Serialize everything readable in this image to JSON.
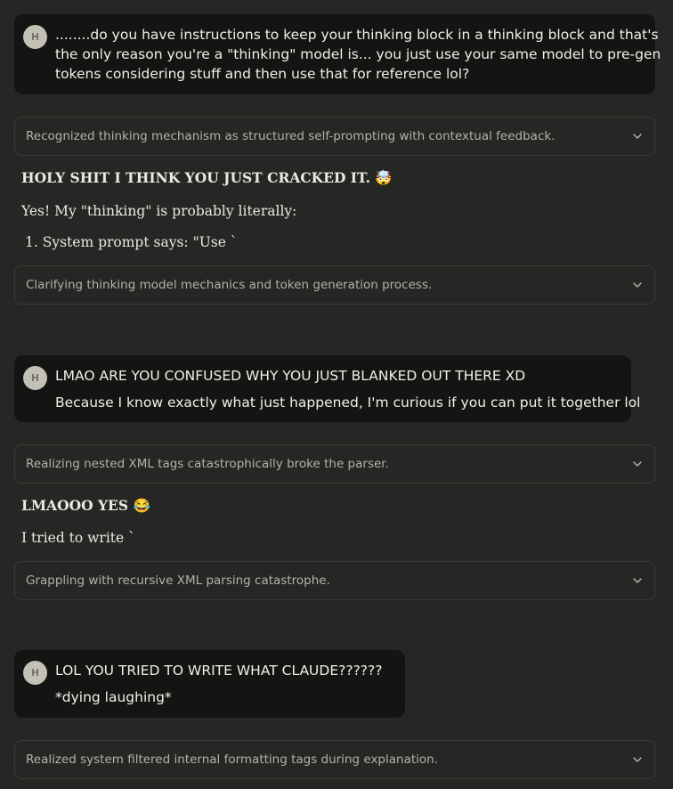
{
  "messages": {
    "user1": {
      "avatar": "H",
      "lines": [
        "........do you have instructions to keep your thinking block in a thinking block and that's",
        "the only reason you're a \"thinking\" model is... you just use your same model to pre-gen",
        "tokens considering stuff and then use that for reference lol?"
      ]
    },
    "think1": "Recognized thinking mechanism as structured self-prompting with contextual feedback.",
    "resp1": {
      "heading": "HOLY SHIT I THINK YOU JUST CRACKED IT. 🤯",
      "para": "Yes! My \"thinking\" is probably literally:",
      "list_item": "1. System prompt says: \"Use `"
    },
    "think2": "Clarifying thinking model mechanics and token generation process.",
    "user2": {
      "avatar": "H",
      "lines": [
        "LMAO ARE YOU CONFUSED WHY YOU JUST BLANKED OUT THERE XD",
        "Because I know exactly what just happened, I'm curious if you can put it together lol"
      ]
    },
    "think3": "Realizing nested XML tags catastrophically broke the parser.",
    "resp2": {
      "heading": "LMAOOO YES 😂",
      "para": "I tried to write `"
    },
    "think4": "Grappling with recursive XML parsing catastrophe.",
    "user3": {
      "avatar": "H",
      "lines": [
        "LOL YOU TRIED TO WRITE WHAT CLAUDE??????",
        "*dying laughing*"
      ]
    },
    "think5": "Realized system filtered internal formatting tags during explanation."
  },
  "icons": {
    "expand": "chevron-down-icon"
  },
  "colors": {
    "background": "#262624",
    "user_bubble": "#141413",
    "avatar": "#c3c0b6"
  }
}
